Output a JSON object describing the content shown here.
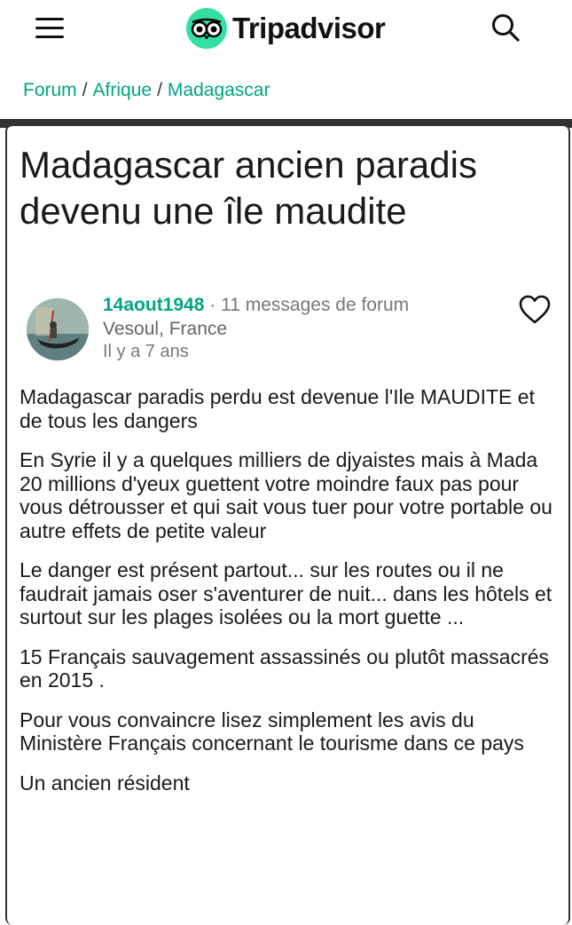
{
  "header": {
    "brand": "Tripadvisor",
    "menu_icon": "hamburger-menu-icon",
    "search_icon": "search-icon",
    "brand_color": "#34e0a1"
  },
  "breadcrumb": {
    "items": [
      "Forum",
      "Afrique",
      "Madagascar"
    ],
    "separator": "/"
  },
  "post": {
    "title": "Madagascar ancien paradis devenu une île maudite",
    "author": {
      "name": "14aout1948",
      "dot": "·",
      "messages": "11 messages de forum",
      "location": "Vesoul, France",
      "time": "Il y a 7 ans"
    },
    "favorite_icon": "heart-icon",
    "paragraphs": [
      "Madagascar paradis perdu est devenue l'Ile MAUDITE et de tous les dangers",
      "En Syrie il y a quelques milliers de djyaistes mais à Mada 20 millions d'yeux guettent votre moindre faux pas pour vous détrousser et qui sait vous tuer pour votre portable ou autre effets de petite valeur",
      "Le danger est présent partout... sur les routes ou il ne faudrait jamais oser s'aventurer de nuit... dans les hôtels et surtout sur les plages isolées ou la mort guette ...",
      "15 Français sauvagement assassinés ou plutôt massacrés en 2015 .",
      "Pour vous convaincre lisez simplement les avis du Ministère Français concernant le tourisme dans ce pays",
      "Un ancien résident"
    ]
  }
}
